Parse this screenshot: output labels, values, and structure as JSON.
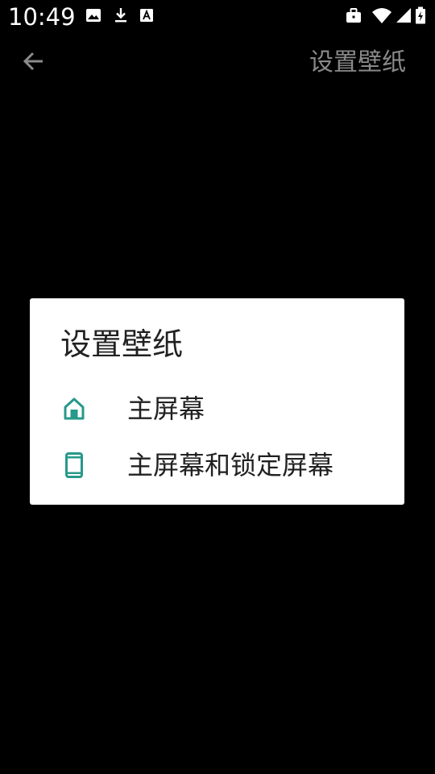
{
  "status_bar": {
    "time": "10:49",
    "left_icons": [
      "image-icon",
      "download-icon",
      "font-a-icon"
    ],
    "right_icons": [
      "briefcase-icon",
      "wifi-icon",
      "signal-icon",
      "battery-icon"
    ]
  },
  "top_bar": {
    "back_icon": "arrow-left-icon",
    "title": "设置壁纸"
  },
  "dialog": {
    "title": "设置壁纸",
    "options": [
      {
        "label": "主屏幕",
        "icon": "home-icon"
      },
      {
        "label": "主屏幕和锁定屏幕",
        "icon": "phone-icon"
      }
    ]
  },
  "colors": {
    "background": "#000000",
    "dialog_bg": "#ffffff",
    "accent": "#26998a",
    "title_dim": "#8a8a8a",
    "text_primary": "#212121"
  }
}
